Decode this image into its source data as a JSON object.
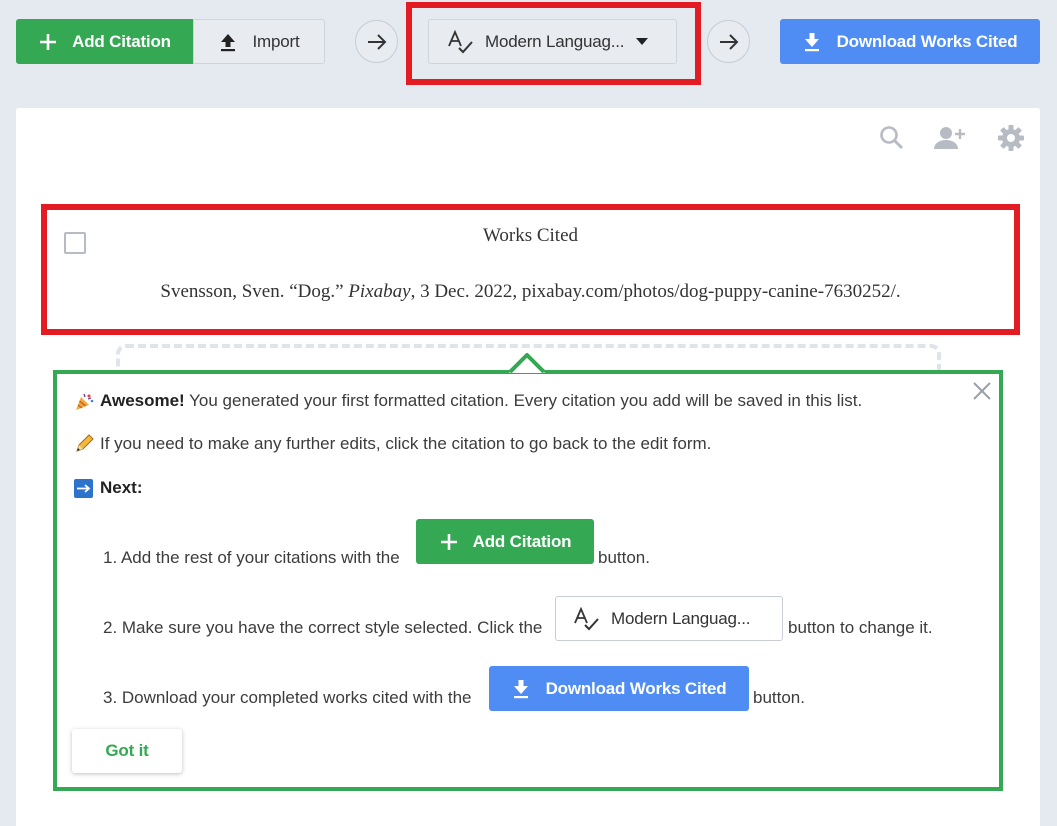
{
  "toolbar": {
    "add_citation": "Add Citation",
    "import": "Import",
    "style": "Modern Languag...",
    "download": "Download Works Cited"
  },
  "list": {
    "title": "Works Cited",
    "citation_author": "Svensson, Sven. “Dog.” ",
    "citation_source": "Pixabay",
    "citation_rest": ", 3 Dec. 2022, pixabay.com/photos/dog-puppy-canine-7630252/."
  },
  "tooltip": {
    "awesome_bold": "Awesome!",
    "awesome_text": " You generated your first formatted citation. Every citation you add will be saved in this list.",
    "edit_text": "If you need to make any further edits, click the citation to go back to the edit form.",
    "next_label": "Next:",
    "step1_before": "1. Add the rest of your citations with the",
    "step1_after": "button.",
    "step2_before": "2. Make sure you have the correct style selected. Click the",
    "step2_after": "button to change it.",
    "step3_before": "3. Download your completed works cited with the",
    "step3_after": "button.",
    "add_citation": "Add Citation",
    "style": "Modern Languag...",
    "download": "Download Works Cited",
    "got_it": "Got it"
  },
  "icons": [
    "plus-icon",
    "upload-icon",
    "arrow-right-icon",
    "spellcheck-icon",
    "caret-down-icon",
    "download-icon",
    "search-icon",
    "add-person-icon",
    "gear-icon",
    "close-icon",
    "party-icon",
    "pencil-icon",
    "arrow-box-icon"
  ],
  "colors": {
    "green": "#34a853",
    "blue": "#4f8df5",
    "red": "#e31b23",
    "bg": "#e5e9f0"
  }
}
